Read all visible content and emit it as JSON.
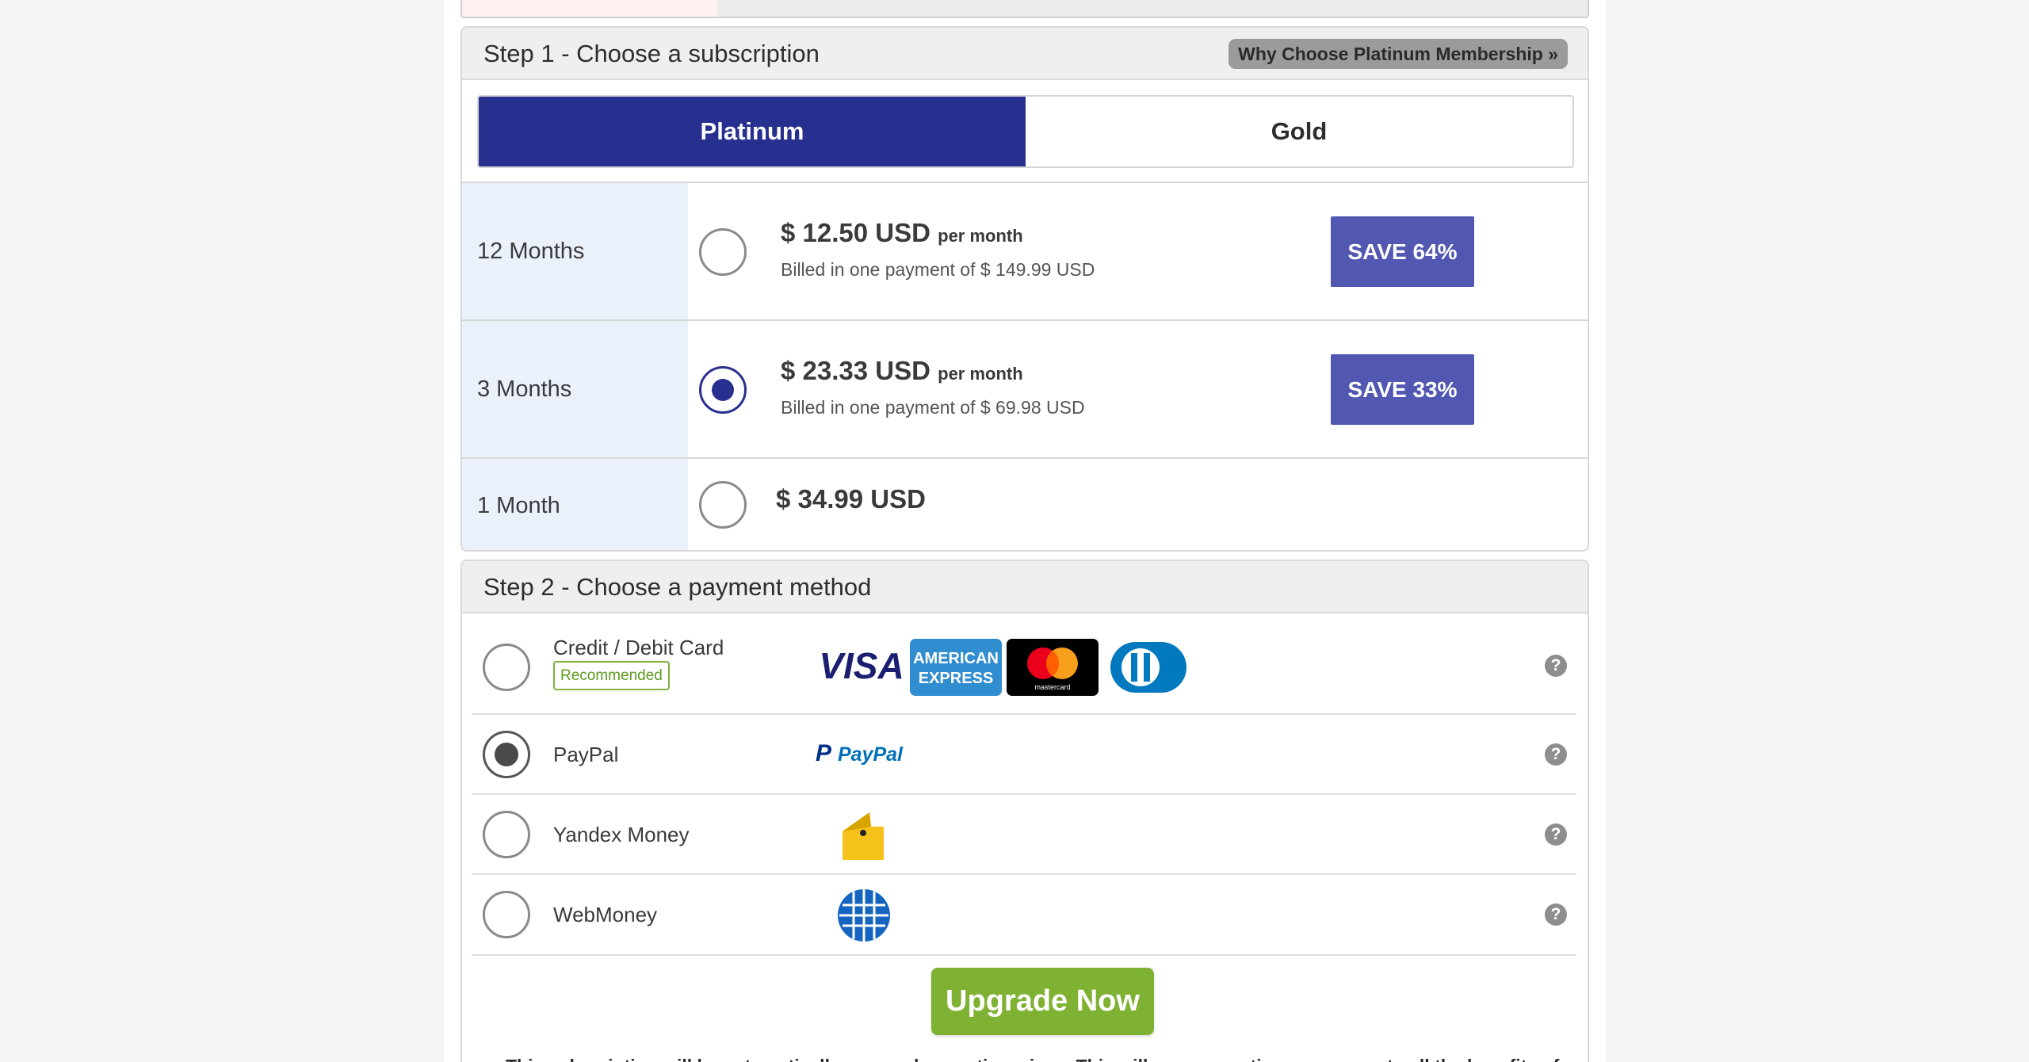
{
  "colors": {
    "primary": "#27308f",
    "save_badge": "#5258b1",
    "upgrade": "#7fb133",
    "recommended": "#5e9b1f",
    "plan_label_bg": "#ebf1fb"
  },
  "step1": {
    "title": "Step 1 - Choose a subscription",
    "why_button": "Why Choose Platinum Membership »",
    "tabs": [
      {
        "label": "Platinum",
        "active": true
      },
      {
        "label": "Gold",
        "active": false
      }
    ],
    "plans": [
      {
        "term": "12 Months",
        "price": "$ 12.50 USD",
        "per": "per month",
        "billed": "Billed in one payment of $ 149.99 USD",
        "save": "SAVE 64%",
        "selected": false
      },
      {
        "term": "3 Months",
        "price": "$ 23.33 USD",
        "per": "per month",
        "billed": "Billed in one payment of $ 69.98 USD",
        "save": "SAVE 33%",
        "selected": true
      },
      {
        "term": "1 Month",
        "price": "$ 34.99 USD",
        "selected": false
      }
    ]
  },
  "step2": {
    "title": "Step 2 - Choose a payment method",
    "methods": [
      {
        "label": "Credit / Debit Card",
        "badge": "Recommended",
        "logos": [
          "visa-logo",
          "american-express-logo",
          "mastercard-logo",
          "diners-club-logo"
        ],
        "selected": false,
        "help": "?"
      },
      {
        "label": "PayPal",
        "logos": [
          "paypal-logo"
        ],
        "selected": true,
        "help": "?"
      },
      {
        "label": "Yandex Money",
        "logos": [
          "yandex-money-logo"
        ],
        "selected": false,
        "help": "?"
      },
      {
        "label": "WebMoney",
        "logos": [
          "webmoney-logo"
        ],
        "selected": false,
        "help": "?"
      }
    ],
    "upgrade_button": "Upgrade Now",
    "footer_note": "This subscription will be automatically renewed every time since. This will ensure continuous access to all the benefits of"
  },
  "logo_text": {
    "visa": "VISA",
    "amex_line1": "AMERICAN",
    "amex_line2": "EXPRESS",
    "mastercard": "mastercard",
    "paypal_p": "P",
    "paypal": "PayPal"
  }
}
